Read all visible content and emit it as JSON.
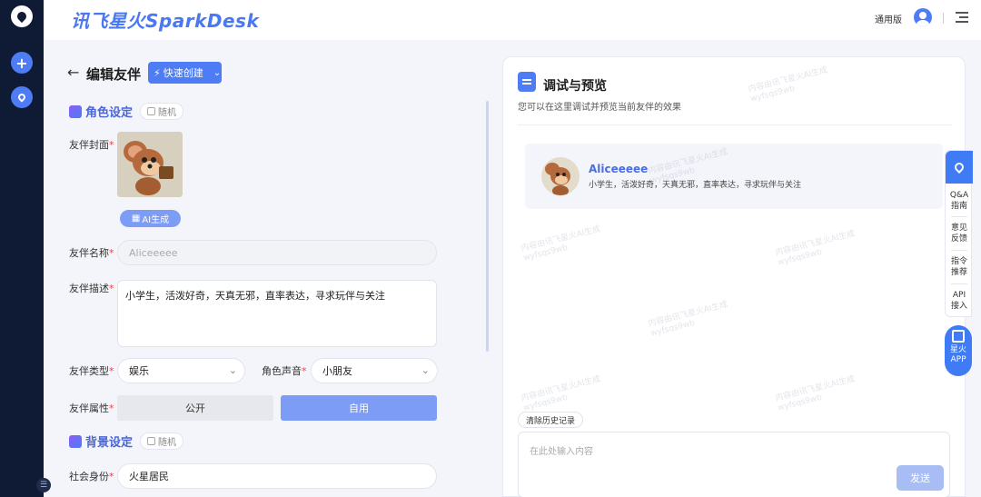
{
  "app": {
    "brand": "讯飞星火SparkDesk",
    "edition": "通用版"
  },
  "editor": {
    "title": "编辑友伴",
    "quick_create": "快速创建",
    "role_section": "角色设定",
    "bg_section": "背景设定",
    "random": "随机",
    "cover_label": "友伴封面",
    "ai_generate": "AI生成",
    "name_label": "友伴名称",
    "name_value": "Aliceeeee",
    "desc_label": "友伴描述",
    "desc_value": "小学生，活泼好奇，天真无邪，直率表达，寻求玩伴与关注",
    "type_label": "友伴类型",
    "type_value": "娱乐",
    "voice_label": "角色声音",
    "voice_value": "小朋友",
    "attr_label": "友伴属性",
    "attr_public": "公开",
    "attr_private": "自用",
    "identity_label": "社会身份",
    "identity_value": "火星居民",
    "required_mark": "*"
  },
  "preview": {
    "title": "调试与预览",
    "subtitle": "您可以在这里调试并预览当前友伴的效果",
    "card_name": "Aliceeeee",
    "card_desc": "小学生，活泼好奇，天真无邪，直率表达，寻求玩伴与关注",
    "clear_history": "清除历史记录",
    "input_placeholder": "在此处输入内容",
    "send": "发送",
    "watermark_line1": "内容由讯飞星火AI生成",
    "watermark_line2": "wyfsqs9wb"
  },
  "float_bar": {
    "items": [
      "Q&A\n指南",
      "意见\n反馈",
      "指令\n推荐",
      "API\n接入"
    ],
    "app": "星火\nAPP"
  },
  "colors": {
    "accent": "#4d7cf4",
    "rail": "#0f1b34",
    "required": "#e54545"
  }
}
